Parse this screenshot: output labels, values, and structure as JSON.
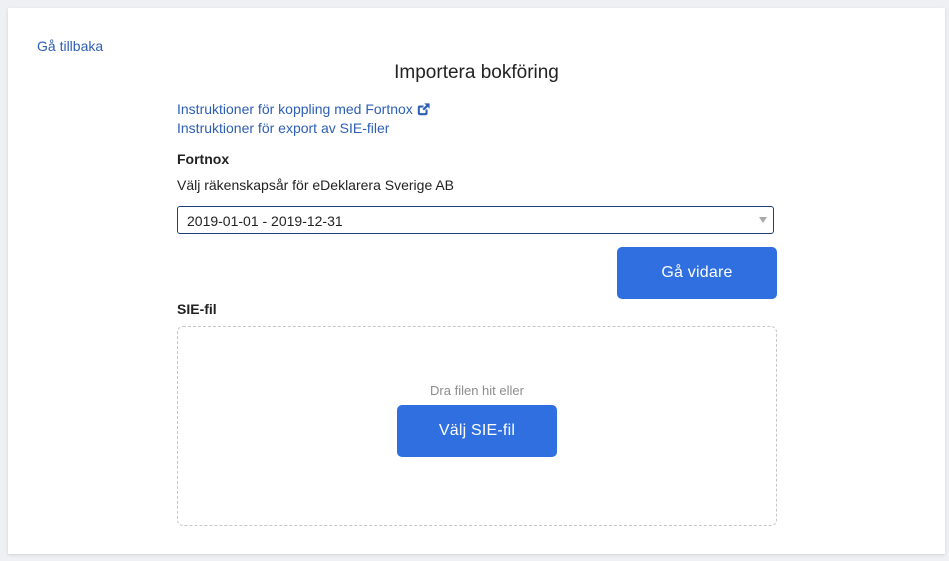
{
  "header": {
    "back_label": "Gå tillbaka",
    "title": "Importera bokföring"
  },
  "links": {
    "fortnox_instructions": "Instruktioner för koppling med Fortnox",
    "fortnox_icon": "external-link-icon",
    "sie_instructions": "Instruktioner för export av SIE-filer"
  },
  "fortnox": {
    "heading": "Fortnox",
    "fiscal_year_label": "Välj räkenskapsår för eDeklarera Sverige AB",
    "selected_fiscal_year": "2019-01-01 - 2019-12-31",
    "continue_button": "Gå vidare"
  },
  "sie": {
    "heading": "SIE-fil",
    "drop_hint": "Dra filen hit eller",
    "choose_button": "Välj SIE-fil"
  },
  "colors": {
    "accent": "#2f6fe0",
    "link": "#2d5fb5",
    "select_border": "#1f3d7a"
  }
}
